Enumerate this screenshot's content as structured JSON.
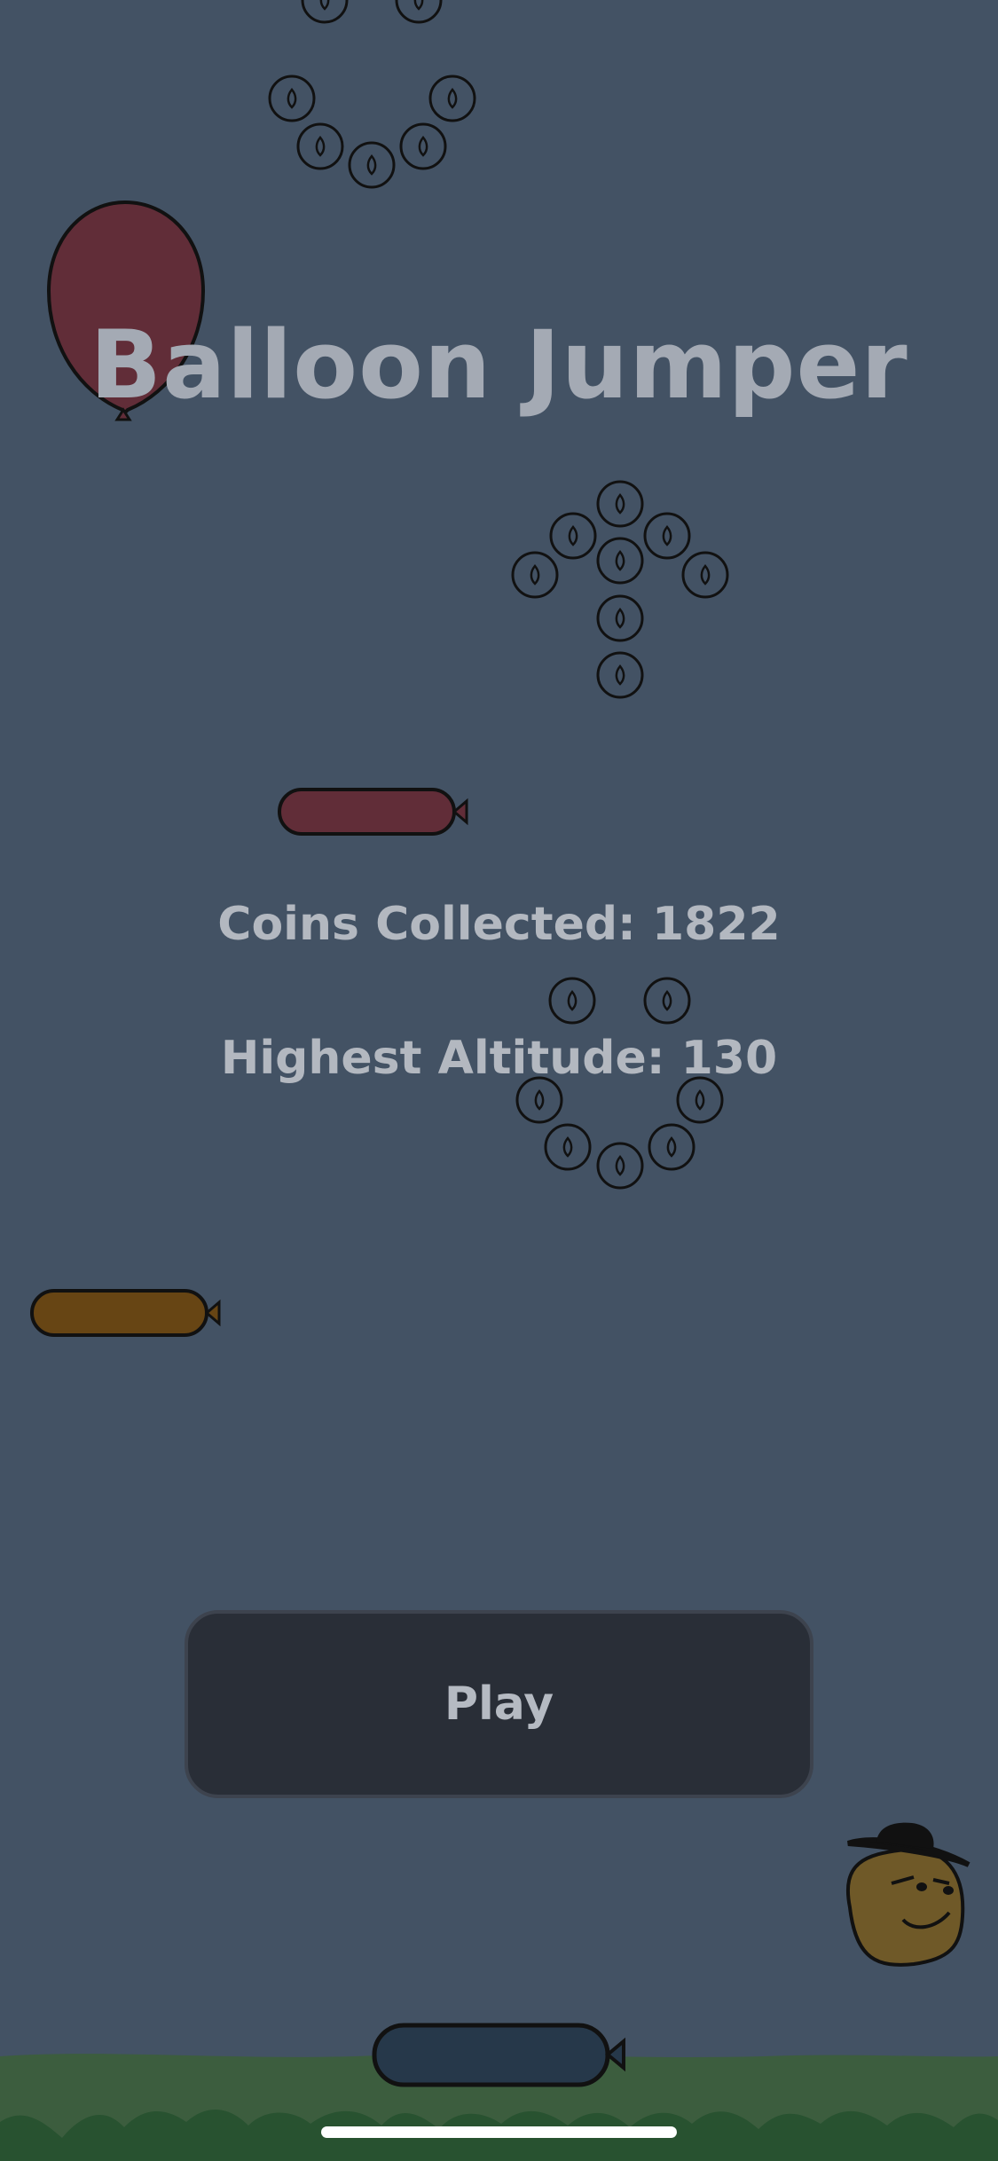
{
  "game": {
    "title": "Balloon Jumper",
    "coins_label": "Coins Collected: 1822",
    "altitude_label": "Highest Altitude: 130",
    "play_label": "Play"
  },
  "colors": {
    "background": "#435264",
    "grass": "#3c5d3e",
    "grass_dark": "#285230",
    "balloon_red": "#612d38",
    "balloon_orange": "#674514",
    "balloon_navy": "#26384a",
    "character": "#6f5928"
  }
}
